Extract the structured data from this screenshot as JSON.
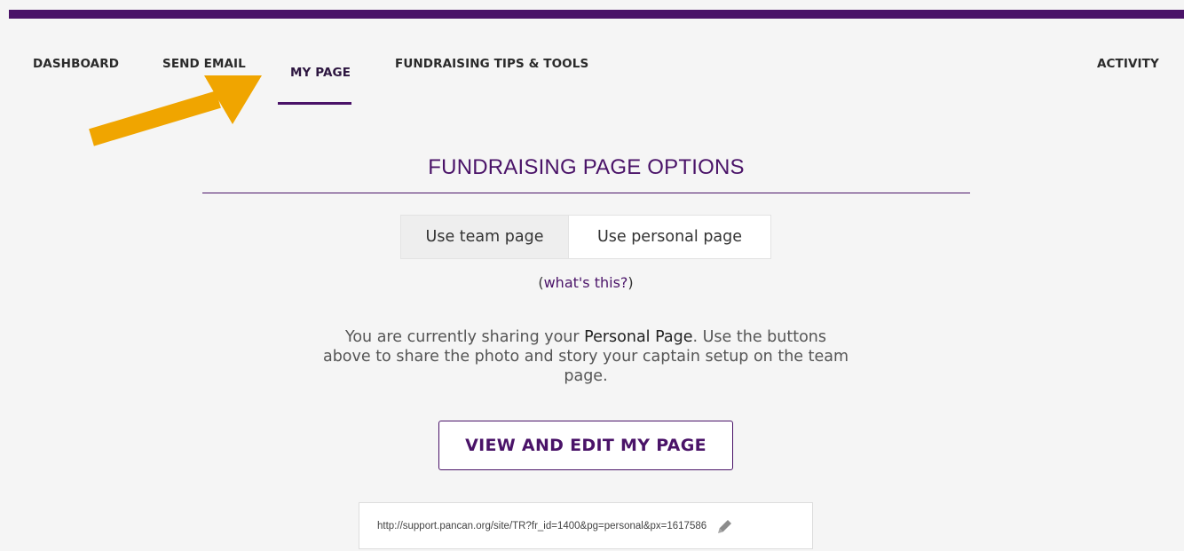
{
  "nav": {
    "items": [
      {
        "label": "DASHBOARD"
      },
      {
        "label": "SEND EMAIL"
      },
      {
        "label": "MY PAGE"
      },
      {
        "label": "FUNDRAISING TIPS & TOOLS"
      },
      {
        "label": "ACTIVITY"
      }
    ],
    "active": "MY PAGE"
  },
  "main": {
    "title": "FUNDRAISING PAGE OPTIONS",
    "toggle": {
      "team_label": "Use team page",
      "personal_label": "Use personal page",
      "selected": "Use personal page"
    },
    "help": {
      "open": "(",
      "link": "what's this?",
      "close": ")"
    },
    "info": {
      "prefix": "You are currently sharing your ",
      "highlight": "Personal Page",
      "suffix": ". Use the buttons above to share the photo and story your captain setup on the team page."
    },
    "view_button": "VIEW AND EDIT MY PAGE",
    "url": "http://support.pancan.org/site/TR?fr_id=1400&pg=personal&px=1617586"
  },
  "colors": {
    "brand": "#4a1368",
    "arrow": "#f0a500",
    "background": "#f5f5f5"
  },
  "icons": {
    "edit": "pencil-icon",
    "annotation": "arrow-annotation"
  }
}
